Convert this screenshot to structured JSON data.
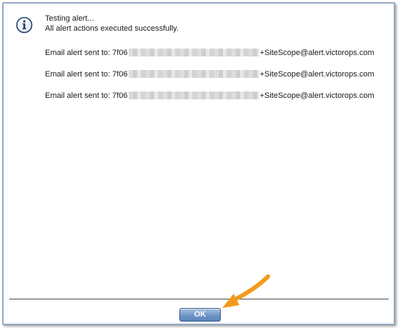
{
  "dialog": {
    "title_line": "Testing alert...",
    "status_line": "All alert actions executed successfully.",
    "emails": [
      {
        "prefix": "Email alert sent to: 7f06",
        "suffix": "+SiteScope@alert.victorops.com"
      },
      {
        "prefix": "Email alert sent to: 7f06",
        "suffix": "+SiteScope@alert.victorops.com"
      },
      {
        "prefix": "Email alert sent to: 7f06",
        "suffix": "+SiteScope@alert.victorops.com"
      }
    ],
    "ok_label": "OK"
  },
  "icons": {
    "info": "info-icon",
    "arrow": "arrow-annotation-icon"
  },
  "colors": {
    "frame_border": "#93a8c3",
    "button_top": "#a9c3e3",
    "button_bottom": "#5a84bb",
    "arrow": "#f39a1e",
    "icon_border": "#1f3d6b"
  }
}
